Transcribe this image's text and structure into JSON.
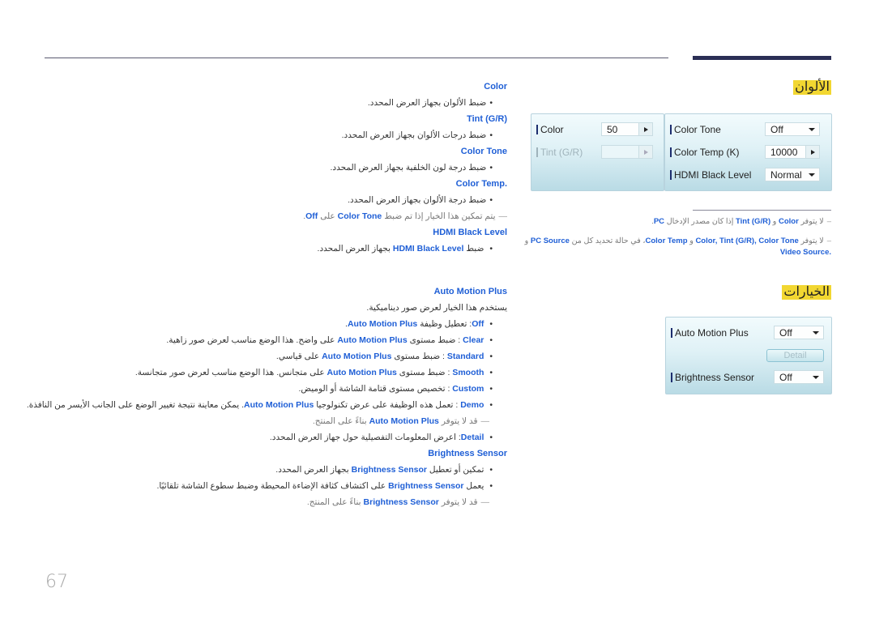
{
  "sections": {
    "colors_title": "الألوان",
    "options_title": "الخيارات"
  },
  "colors_text": {
    "color_head": "Color",
    "color_desc": "ضبط الألوان بجهاز العرض المحدد.",
    "tint_head": "(Tint (G/R",
    "tint_desc": "ضبط درجات الألوان بجهاز العرض المحدد.",
    "tone_head": "Color Tone",
    "tone_desc": "ضبط درجة لون الخلفية بجهاز العرض المحدد.",
    "temp_head": ".Color Temp",
    "temp_desc": "ضبط درجة الألوان بجهاز العرض المحدد.",
    "temp_note_pre": "يتم تمكين هذا الخيار إذا تم ضبط",
    "temp_note_kw": "Color Tone",
    "temp_note_mid": "على",
    "temp_note_kw2": "Off",
    "hdmi_head": "HDMI Black Level",
    "hdmi_desc_pre": "ضبط",
    "hdmi_desc_kw": "HDMI Black Level",
    "hdmi_desc_post": "بجهاز العرض المحدد."
  },
  "colors_panel": {
    "left": {
      "rows": [
        {
          "label": "Color",
          "value": "50",
          "control": "stepper",
          "enabled": true
        },
        {
          "label": "Tint (G/R)",
          "value": "",
          "control": "stepper",
          "enabled": false
        }
      ]
    },
    "right": {
      "rows": [
        {
          "label": "Color Tone",
          "value": "Off",
          "control": "dropdown",
          "enabled": true
        },
        {
          "label": "Color Temp (K)",
          "value": "10000",
          "control": "stepper",
          "enabled": true
        },
        {
          "label": "HDMI Black Level",
          "value": "Normal",
          "control": "dropdown",
          "enabled": true
        }
      ]
    }
  },
  "colors_notes": {
    "note1_pre": "لا يتوفر",
    "note1_kw1": "Color",
    "note1_and": "و",
    "note1_kw2": "Tint (G/R)",
    "note1_mid": "إذا كان مصدر الإدخال",
    "note1_kw3": "PC",
    "note2_pre": "لا يتوفر",
    "note2_kw1": "Color, Tint (G/R), Color Tone",
    "note2_and": "و",
    "note2_kw2": "Color Temp",
    "note2_mid": "، في حالة تحديد كل من",
    "note2_kw3": "PC Source",
    "note2_and2": "و",
    "note2_kw4": ".Video Source"
  },
  "options_text": {
    "amp_head": "Auto Motion Plus",
    "amp_desc": "يستخدم هذا الخيار لعرض صور ديناميكية.",
    "items": [
      {
        "key": "Off",
        "sep": ": تعطيل وظيفة",
        "kw": "Auto Motion Plus",
        "rest": "."
      },
      {
        "key": "Clear",
        "sep": " : ضبط مستوى",
        "kw": "Auto Motion Plus",
        "rest": "على واضح. هذا الوضع مناسب لعرض صور زاهية."
      },
      {
        "key": "Standard",
        "sep": " : ضبط مستوى",
        "kw": "Auto Motion Plus",
        "rest": "على قياسي."
      },
      {
        "key": "Smooth",
        "sep": " : ضبط مستوى",
        "kw": "Auto Motion Plus",
        "rest": "على متجانس. هذا الوضع مناسب لعرض صور متجانسة."
      },
      {
        "key": "Custom",
        "sep": " : تخصيص مستوى قتامة الشاشة أو الوميض.",
        "kw": "",
        "rest": ""
      },
      {
        "key": "Demo",
        "sep": " : تعمل هذه الوظيفة على عرض تكنولوجيا",
        "kw": "Auto Motion Plus",
        "rest": ". يمكن معاينة نتيجة تغيير الوضع على الجانب الأيسر من النافذة."
      }
    ],
    "amp_note_pre": "قد لا يتوفر",
    "amp_note_kw": "Auto Motion Plus",
    "amp_note_post": "بناءً على المنتج.",
    "detail_key": "Detail",
    "detail_desc": ": اعرض المعلومات التفصيلية حول جهاز العرض المحدد.",
    "bs_head": "Brightness Sensor",
    "bs_item1_pre": "تمكين أو تعطيل",
    "bs_item1_kw": "Brightness Sensor",
    "bs_item1_post": "بجهاز العرض المحدد.",
    "bs_item2_pre": "يعمل",
    "bs_item2_kw": "Brightness Sensor",
    "bs_item2_post": "على اكتشاف كثافة الإضاءة المحيطة وضبط سطوع الشاشة تلقائيًا.",
    "bs_note_pre": "قد لا يتوفر",
    "bs_note_kw": "Brightness Sensor",
    "bs_note_post": "بناءً على المنتج."
  },
  "options_panel": {
    "rows": [
      {
        "label": "Auto Motion Plus",
        "value": "Off",
        "control": "dropdown"
      },
      {
        "label": "Brightness Sensor",
        "value": "Off",
        "control": "dropdown"
      }
    ],
    "detail_button": "Detail"
  },
  "page_number": "67"
}
